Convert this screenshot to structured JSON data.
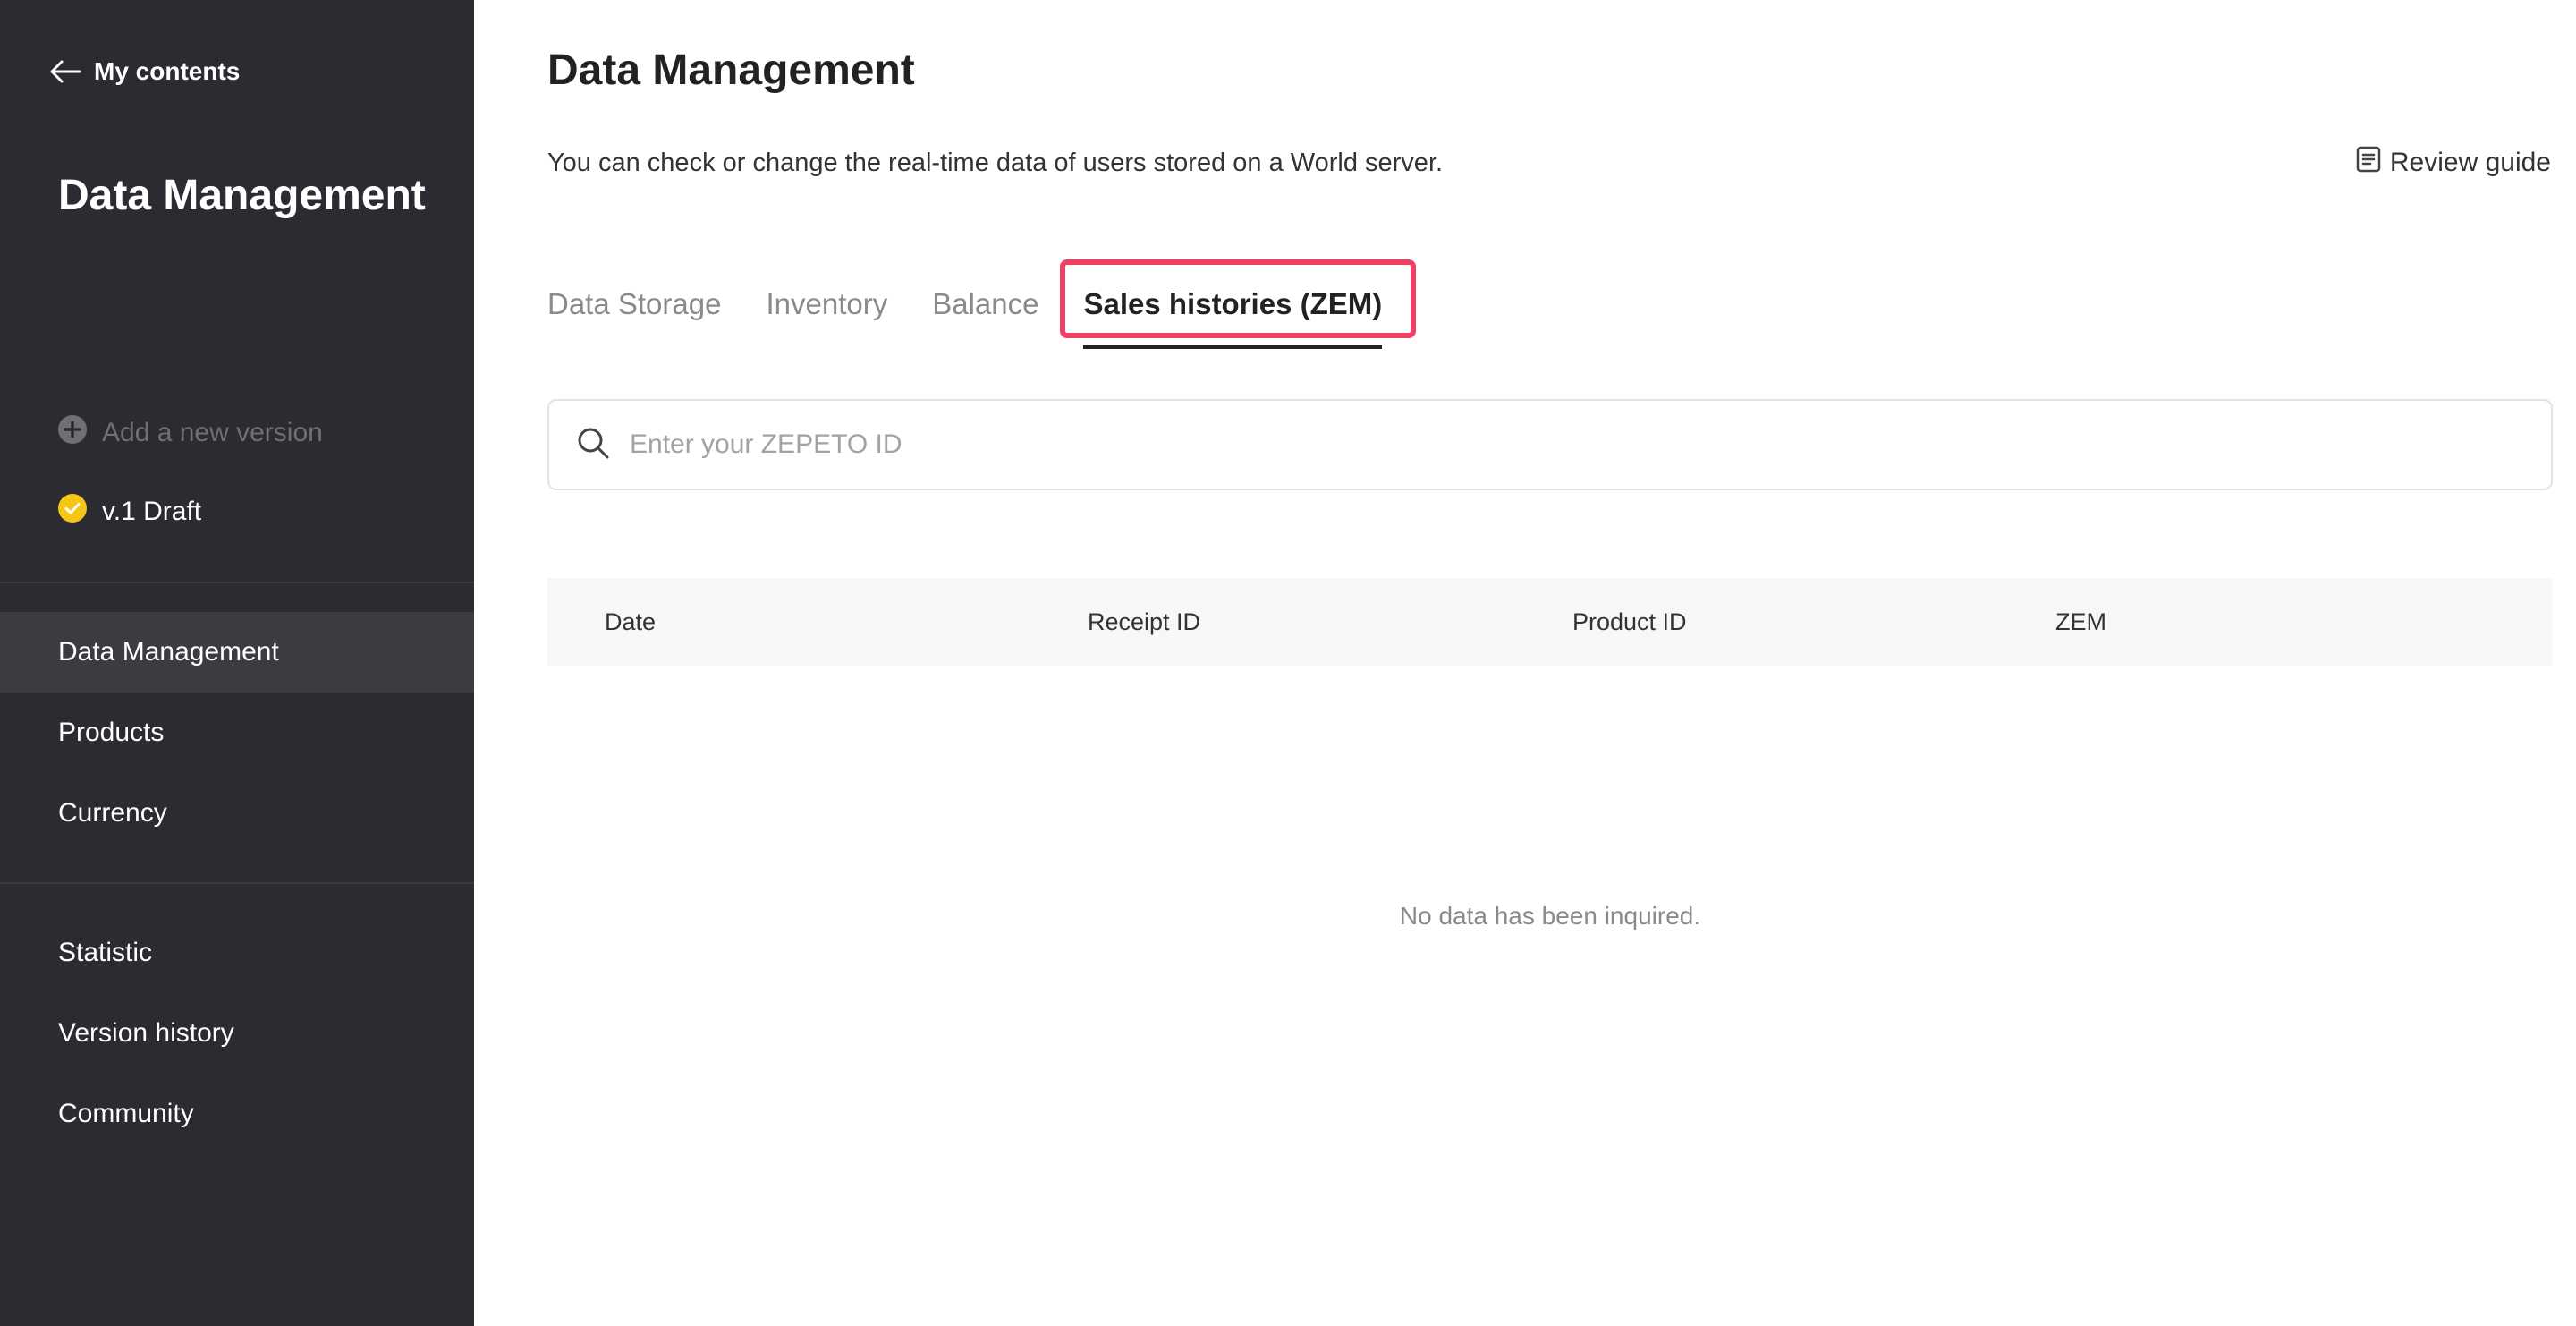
{
  "sidebar": {
    "back_label": "My contents",
    "title": "Data Management",
    "add_version_label": "Add a new version",
    "version_label": "v.1 Draft",
    "nav_primary": [
      {
        "label": "Data Management",
        "active": true
      },
      {
        "label": "Products",
        "active": false
      },
      {
        "label": "Currency",
        "active": false
      }
    ],
    "nav_secondary": [
      {
        "label": "Statistic"
      },
      {
        "label": "Version history"
      },
      {
        "label": "Community"
      }
    ]
  },
  "main": {
    "title": "Data Management",
    "description": "You can check or change the real-time data of users stored on a World server.",
    "review_guide_label": "Review guide",
    "tabs": [
      {
        "label": "Data Storage"
      },
      {
        "label": "Inventory"
      },
      {
        "label": "Balance"
      },
      {
        "label": "Sales histories (ZEM)",
        "active": true
      }
    ],
    "search": {
      "placeholder": "Enter your ZEPETO ID"
    },
    "table": {
      "columns": [
        "Date",
        "Receipt ID",
        "Product ID",
        "ZEM"
      ],
      "empty_message": "No data has been inquired."
    }
  },
  "colors": {
    "sidebar_bg": "#2b2c31",
    "accent_highlight": "#f04064",
    "version_badge": "#f5c518"
  }
}
